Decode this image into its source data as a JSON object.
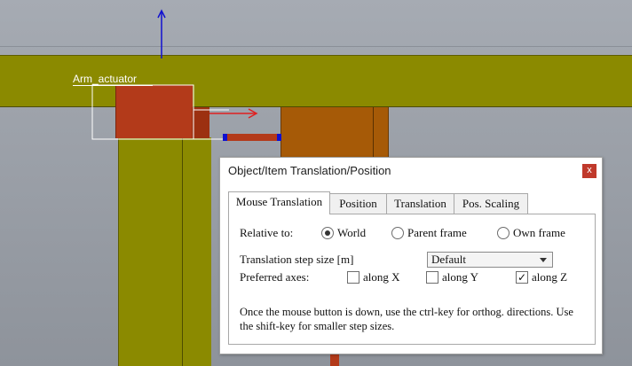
{
  "scene": {
    "object_label": "Arm_actuator"
  },
  "dialog": {
    "title": "Object/Item Translation/Position",
    "close_label": "x",
    "tabs": [
      {
        "label": "Mouse Translation",
        "active": true
      },
      {
        "label": "Position",
        "active": false
      },
      {
        "label": "Translation",
        "active": false
      },
      {
        "label": "Pos. Scaling",
        "active": false
      }
    ],
    "relative_to": {
      "label": "Relative to:",
      "options": [
        {
          "label": "World",
          "selected": true
        },
        {
          "label": "Parent frame",
          "selected": false
        },
        {
          "label": "Own frame",
          "selected": false
        }
      ]
    },
    "step_size": {
      "label": "Translation step size [m]",
      "value": "Default"
    },
    "preferred_axes": {
      "label": "Preferred axes:",
      "options": [
        {
          "label": "along X",
          "checked": false
        },
        {
          "label": "along Y",
          "checked": false
        },
        {
          "label": "along Z",
          "checked": true
        }
      ]
    },
    "info_text": "Once the mouse button is down, use the ctrl-key for orthog. directions. Use the shift-key for smaller step sizes."
  },
  "colors": {
    "beam": "#8b8a00",
    "actuator": "#b33a1a",
    "block": "#a65a07",
    "axis_z": "#1010d0",
    "axis_x": "#e02020",
    "close_button": "#c0392b"
  }
}
